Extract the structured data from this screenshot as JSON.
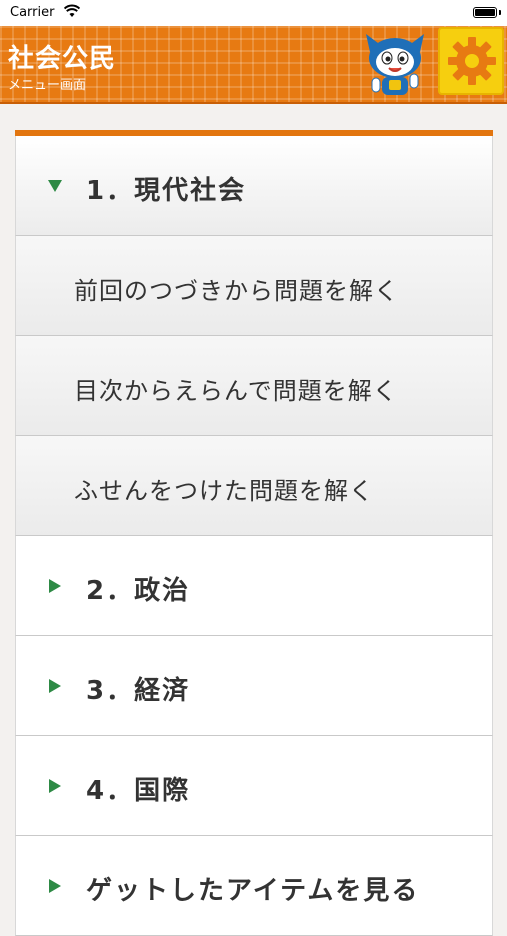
{
  "status_bar": {
    "carrier": "Carrier"
  },
  "header": {
    "title": "社会公民",
    "subtitle": "メニュー画面"
  },
  "menu": {
    "sections": [
      {
        "label": "1．現代社会",
        "expanded": true
      },
      {
        "label": "2．政治",
        "expanded": false
      },
      {
        "label": "3．経済",
        "expanded": false
      },
      {
        "label": "4．国際",
        "expanded": false
      },
      {
        "label": "ゲットしたアイテムを見る",
        "expanded": false
      }
    ],
    "sub_items": [
      {
        "label": "前回のつづきから問題を解く"
      },
      {
        "label": "目次からえらんで問題を解く"
      },
      {
        "label": "ふせんをつけた問題を解く"
      }
    ]
  },
  "icons": {
    "wifi": "wifi-icon",
    "battery": "battery-icon",
    "mascot": "mascot-character",
    "settings": "gear-icon",
    "expand": "triangle-right-icon",
    "collapse": "triangle-down-icon"
  },
  "colors": {
    "header_orange": "#e77a12",
    "gear_yellow": "#f6cf0f",
    "caret_green": "#2e8a45"
  }
}
